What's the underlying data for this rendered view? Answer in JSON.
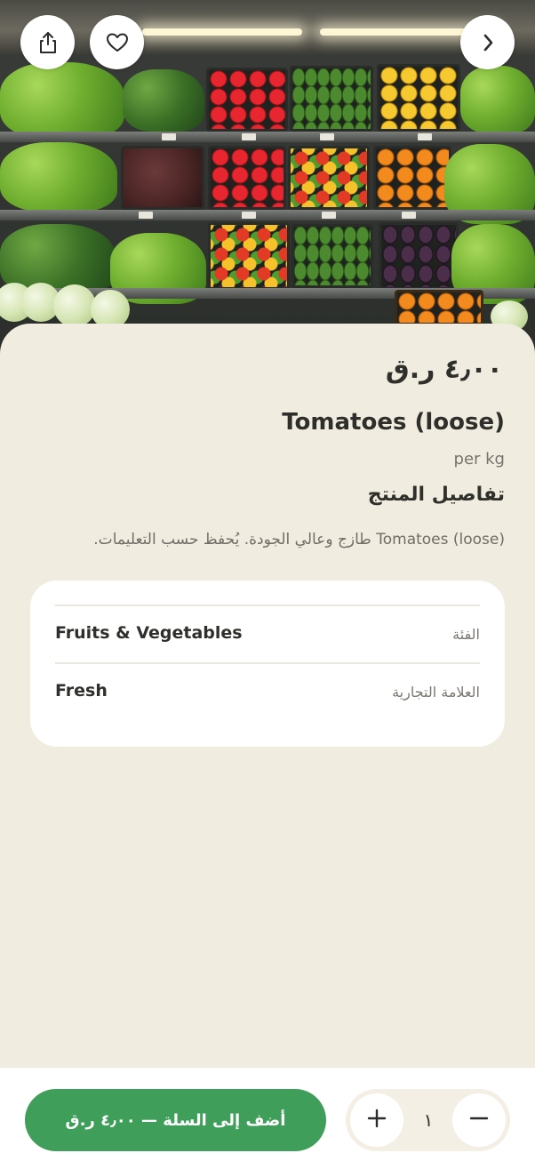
{
  "product": {
    "price": "٤٫٠٠ ر.ق",
    "title": "Tomatoes (loose)",
    "unit": "per kg",
    "details_heading": "تفاصيل المنتج",
    "description": "Tomatoes (loose) طازج وعالي الجودة. يُحفظ حسب التعليمات."
  },
  "details": [
    {
      "label": "الفئة",
      "value": "Fruits & Vegetables"
    },
    {
      "label": "العلامة التجارية",
      "value": "Fresh"
    }
  ],
  "top_actions": {
    "share_icon": "share-icon",
    "favorite_icon": "heart-icon",
    "forward_icon": "chevron-right-icon"
  },
  "cart": {
    "add_label": "أضف إلى السلة — ٤٫٠٠ ر.ق",
    "quantity": "١",
    "increment_icon": "plus-icon",
    "decrement_icon": "minus-icon"
  },
  "colors": {
    "background": "#f1ece0",
    "accent_green": "#3f9f5a",
    "card": "#ffffff",
    "text_primary": "#2f2f2b",
    "text_secondary": "#76746d"
  }
}
